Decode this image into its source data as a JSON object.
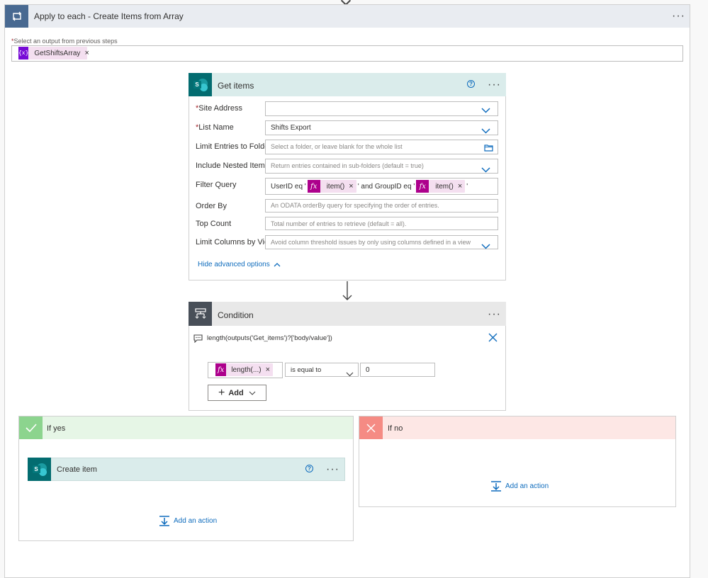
{
  "apply_each": {
    "title": "Apply to each - Create Items from Array",
    "select_label": "Select an output from previous steps",
    "token": "GetShiftsArray",
    "token_icon": "{x}"
  },
  "get_items": {
    "title": "Get items",
    "help": "?",
    "fields": {
      "site_address": {
        "label": "Site Address",
        "value": ""
      },
      "list_name": {
        "label": "List Name",
        "value": "Shifts Export"
      },
      "limit_folder": {
        "label": "Limit Entries to Folder",
        "placeholder": "Select a folder, or leave blank for the whole list"
      },
      "nested": {
        "label": "Include Nested Items",
        "placeholder": "Return entries contained in sub-folders (default = true)"
      },
      "filter": {
        "label": "Filter Query",
        "text1": "UserID eq '",
        "token1": "item()",
        "text2": "' and GroupID eq '",
        "token2": "item()",
        "text3": "'"
      },
      "order_by": {
        "label": "Order By",
        "placeholder": "An ODATA orderBy query for specifying the order of entries."
      },
      "top_count": {
        "label": "Top Count",
        "placeholder": "Total number of entries to retrieve (default = all)."
      },
      "limit_view": {
        "label": "Limit Columns by View",
        "placeholder": "Avoid column threshold issues by only using columns defined in a view"
      }
    },
    "hide_advanced": "Hide advanced options"
  },
  "condition": {
    "title": "Condition",
    "expression": "length(outputs('Get_items')?['body/value'])",
    "left_token": "length(...)",
    "operator": "is equal to",
    "right_value": "0",
    "add_label": "Add"
  },
  "if_yes": {
    "title": "If yes",
    "create_item_title": "Create item",
    "help": "?",
    "add_action": "Add an action",
    "color": "#8cd48e"
  },
  "if_no": {
    "title": "If no",
    "add_action": "Add an action",
    "color": "#f58b84"
  },
  "colors": {
    "loop_badge": "#486991",
    "sharepoint": "#036c70",
    "condition_badge": "#484f58",
    "token_variable": "#770bd6",
    "token_expression": "#ad008c",
    "link": "#0f6cbd"
  },
  "icons": {
    "loop": "loop-icon",
    "condition": "condition-icon",
    "check": "check-icon",
    "x": "x-icon",
    "fx": "fx-icon",
    "add_action": "add-action-icon",
    "comment": "comment-icon"
  }
}
